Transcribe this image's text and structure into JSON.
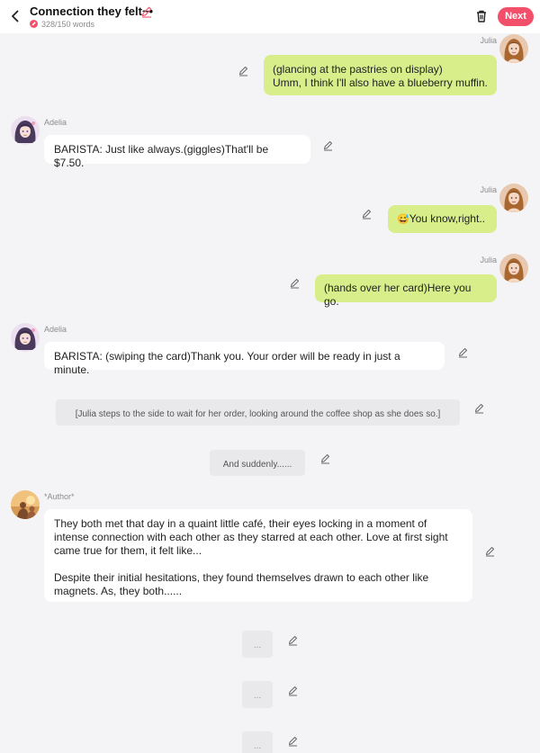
{
  "header": {
    "title": "Connection they felt~•",
    "word_count": "328/150 words",
    "next_label": "Next"
  },
  "messages": [
    {
      "speaker": "Julia",
      "lines": [
        "(glancing at the pastries on display)",
        "Umm, I think I'll also have a blueberry muffin."
      ]
    },
    {
      "speaker": "Adelia",
      "lines": [
        "BARISTA: Just like always.(giggles)That'll be $7.50."
      ]
    },
    {
      "speaker": "Julia",
      "emoji": "😅",
      "lines": [
        "You know,right.."
      ]
    },
    {
      "speaker": "Julia",
      "lines": [
        "(hands over her card)Here you go."
      ]
    },
    {
      "speaker": "Adelia",
      "lines": [
        "BARISTA: (swiping the card)Thank you. Your order will be ready in just a minute."
      ]
    },
    {
      "speaker": "",
      "lines": [
        "[Julia steps to the side to wait for her order, looking around the coffee shop as she does so.]"
      ]
    },
    {
      "speaker": "",
      "lines": [
        "And suddenly......"
      ]
    },
    {
      "speaker": "*Author*",
      "lines": [
        "They both met that day in a quaint little café, their eyes locking in a moment of",
        "intense connection with each other as they starred at each other. Love at first sight",
        "came true for them, it felt like...",
        "",
        "Despite their initial hesitations, they found themselves drawn to each other like",
        "magnets. As, they both......"
      ]
    },
    {
      "speaker": "",
      "lines": [
        "..."
      ]
    },
    {
      "speaker": "",
      "lines": [
        "..."
      ]
    },
    {
      "speaker": "",
      "lines": [
        "..."
      ]
    }
  ]
}
